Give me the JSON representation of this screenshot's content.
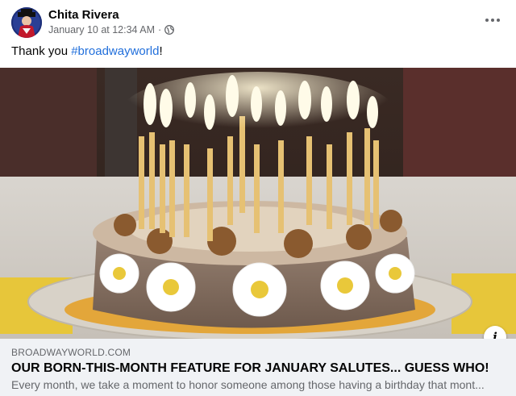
{
  "post": {
    "author": "Chita Rivera",
    "timestamp": "January 10 at 12:34 AM",
    "separator": "·",
    "privacy_icon": "globe-icon",
    "text_prefix": "Thank you ",
    "hashtag": "#broadwayworld",
    "text_suffix": "!"
  },
  "link_card": {
    "domain": "BROADWAYWORLD.COM",
    "title": "OUR BORN-THIS-MONTH FEATURE FOR JANUARY SALUTES... GUESS WHO!",
    "description": "Every month, we take a moment to honor someone among those having a birthday that mont..."
  },
  "colors": {
    "hashtag": "#216fdb",
    "meta_text": "#65676b",
    "card_bg": "#f0f2f5"
  }
}
